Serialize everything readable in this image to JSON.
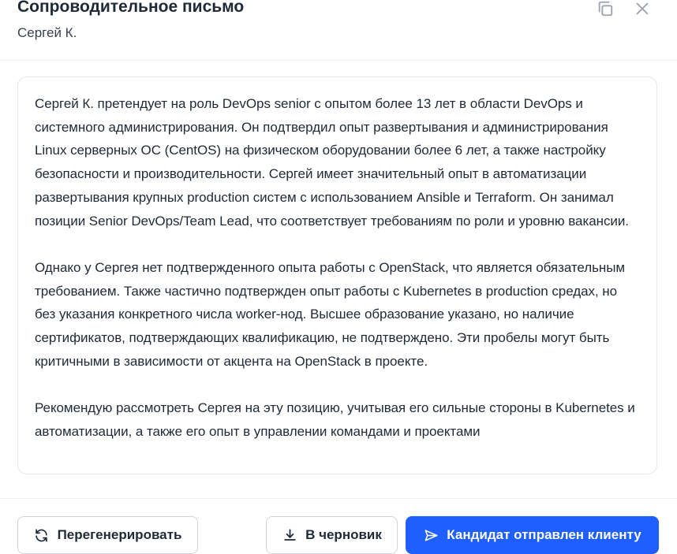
{
  "header": {
    "title": "Сопроводительное письмо",
    "subtitle": "Сергей К.",
    "copy_icon": "copy-icon",
    "close_icon": "close-icon"
  },
  "letter": {
    "paragraphs": [
      "Сергей К. претендует на роль DevOps senior с опытом более 13 лет в области DevOps и системного администрирования. Он подтвердил опыт развертывания и администрирования Linux серверных ОС (CentOS) на физическом оборудовании более 6 лет, а также настройку безопасности и производительности. Сергей имеет значительный опыт в автоматизации развертывания крупных production систем с использованием Ansible и Terraform. Он занимал позиции Senior DevOps/Team Lead, что соответствует требованиям по роли и уровню вакансии.",
      "Однако у Сергея нет подтвержденного опыта работы с OpenStack, что является обязательным требованием. Также частично подтвержден опыт работы с Kubernetes в production средах, но без указания конкретного числа worker-нод. Высшее образование указано, но наличие сертификатов, подтверждающих квалификацию, не подтверждено. Эти пробелы могут быть критичными в зависимости от акцента на OpenStack в проекте.",
      "Рекомендую рассмотреть Сергея на эту позицию, учитывая его сильные стороны в Kubernetes и автоматизации, а также его опыт в управлении командами и проектами"
    ]
  },
  "footer": {
    "regenerate_label": "Перегенерировать",
    "draft_label": "В черновик",
    "send_label": "Кандидат отправлен клиенту",
    "regenerate_icon": "refresh-icon",
    "draft_icon": "download-icon",
    "send_icon": "send-icon"
  },
  "colors": {
    "primary": "#1f5eff",
    "text": "#1f2937",
    "border": "#e5e7eb",
    "icon_muted": "#9ca3af"
  }
}
